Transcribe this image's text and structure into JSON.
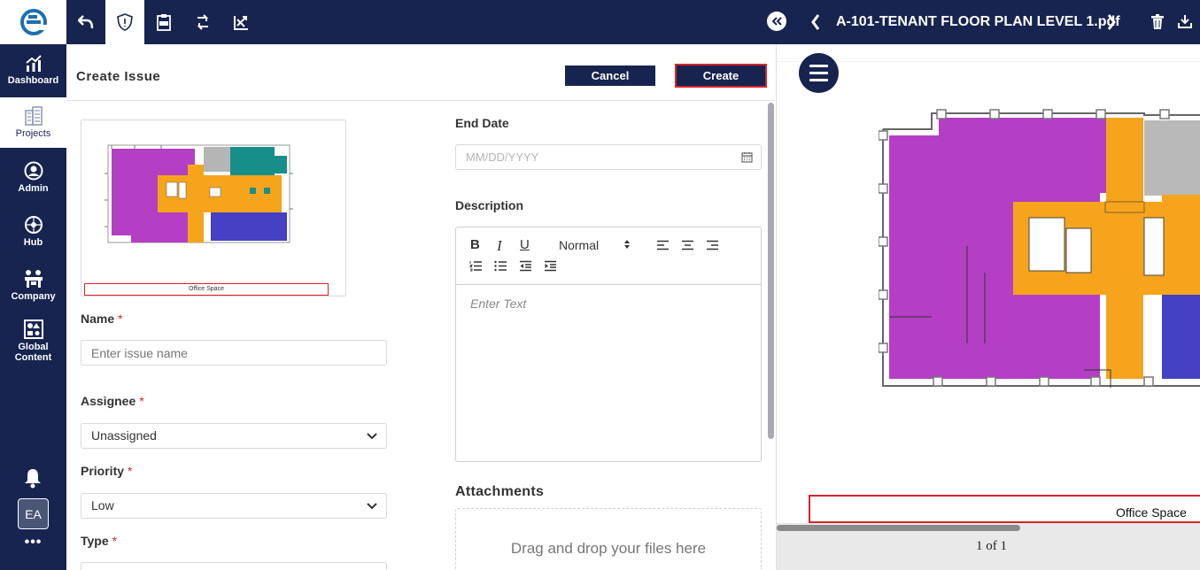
{
  "app": {
    "logo_icon": "brand-e-logo-icon",
    "accent": "#172450",
    "required_color": "#d9222a"
  },
  "nav": {
    "items": [
      {
        "label": "Dashboard",
        "icon": "chart-icon"
      },
      {
        "label": "Projects",
        "icon": "buildings-icon"
      },
      {
        "label": "Admin",
        "icon": "user-circle-icon"
      },
      {
        "label": "Hub",
        "icon": "globe-hub-icon"
      },
      {
        "label": "Company",
        "icon": "company-icon"
      },
      {
        "label": "Global\nContent",
        "icon": "shapes-icon"
      }
    ],
    "avatar_initials": "EA",
    "more": "•••"
  },
  "toolbar": {
    "icons": [
      "undo-icon",
      "shield-issue-icon",
      "rfi-icon",
      "sync-icon",
      "markup-icon"
    ]
  },
  "pdf": {
    "title": "A-101-TENANT FLOOR PLAN LEVEL 1.pdf",
    "page_indicator": "1 of 1",
    "office_label": "Office Space"
  },
  "form": {
    "title": "Create Issue",
    "cancel_label": "Cancel",
    "create_label": "Create",
    "thumbnail_label": "Office Space",
    "name": {
      "label": "Name",
      "required": "*",
      "placeholder": "Enter issue name",
      "value": ""
    },
    "assignee": {
      "label": "Assignee",
      "required": "*",
      "value": "Unassigned"
    },
    "priority": {
      "label": "Priority",
      "required": "*",
      "value": "Low"
    },
    "type": {
      "label": "Type",
      "required": "*"
    },
    "end_date": {
      "label": "End Date",
      "placeholder": "MM/DD/YYYY"
    },
    "description": {
      "label": "Description",
      "format_value": "Normal",
      "placeholder": "Enter Text",
      "toolbar": [
        "bold-icon",
        "italic-icon",
        "underline-icon",
        "align-left-icon",
        "align-center-icon",
        "align-right-icon",
        "ordered-list-icon",
        "bullet-list-icon",
        "outdent-icon",
        "indent-icon"
      ]
    },
    "attachments": {
      "label": "Attachments",
      "drop_text": "Drag and drop your files here"
    }
  }
}
